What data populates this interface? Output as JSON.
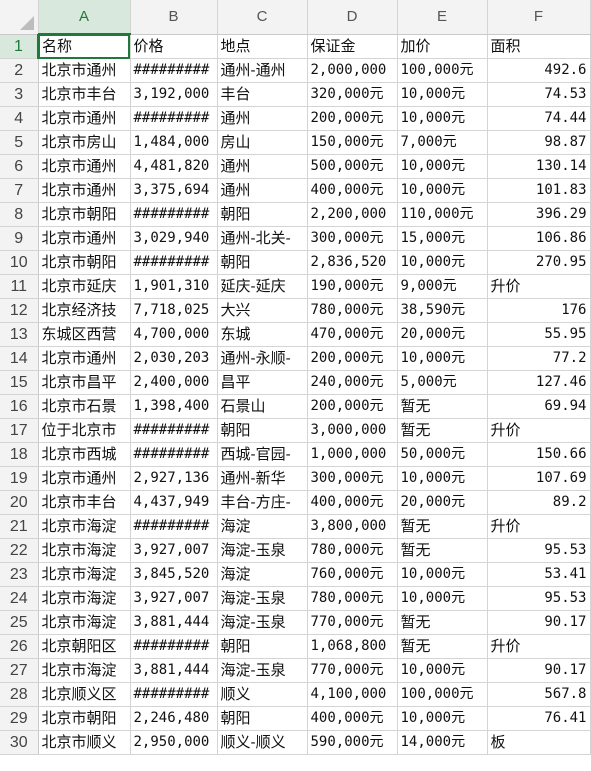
{
  "columns": [
    "A",
    "B",
    "C",
    "D",
    "E",
    "F"
  ],
  "active_column": "A",
  "active_row": 1,
  "rows": [
    {
      "n": "1",
      "cells": [
        "名称",
        "价格",
        "地点",
        "保证金",
        "加价",
        "面积"
      ]
    },
    {
      "n": "2",
      "cells": [
        "北京市通州",
        "#########",
        "通州-通州",
        "2,000,000",
        "100,000元",
        "492.6"
      ]
    },
    {
      "n": "3",
      "cells": [
        "北京市丰台",
        "3,192,000",
        "丰台",
        "320,000元",
        "10,000元",
        "74.53"
      ]
    },
    {
      "n": "4",
      "cells": [
        "北京市通州",
        "#########",
        "通州",
        "200,000元",
        "10,000元",
        "74.44"
      ]
    },
    {
      "n": "5",
      "cells": [
        "北京市房山",
        "1,484,000",
        "房山",
        "150,000元",
        "7,000元",
        "98.87"
      ]
    },
    {
      "n": "6",
      "cells": [
        "北京市通州",
        "4,481,820",
        "通州",
        "500,000元",
        "10,000元",
        "130.14"
      ]
    },
    {
      "n": "7",
      "cells": [
        "北京市通州",
        "3,375,694",
        "通州",
        "400,000元",
        "10,000元",
        "101.83"
      ]
    },
    {
      "n": "8",
      "cells": [
        "北京市朝阳",
        "#########",
        "朝阳",
        "2,200,000",
        "110,000元",
        "396.29"
      ]
    },
    {
      "n": "9",
      "cells": [
        "北京市通州",
        "3,029,940",
        "通州-北关-",
        "300,000元",
        "15,000元",
        "106.86"
      ]
    },
    {
      "n": "10",
      "cells": [
        "北京市朝阳",
        "#########",
        "朝阳",
        "2,836,520",
        "10,000元",
        "270.95"
      ]
    },
    {
      "n": "11",
      "cells": [
        "北京市延庆",
        "1,901,310",
        "延庆-延庆",
        "190,000元",
        "9,000元",
        "升价"
      ]
    },
    {
      "n": "12",
      "cells": [
        "北京经济技",
        "7,718,025",
        "大兴",
        "780,000元",
        "38,590元",
        "176"
      ]
    },
    {
      "n": "13",
      "cells": [
        "东城区西营",
        "4,700,000",
        "东城",
        "470,000元",
        "20,000元",
        "55.95"
      ]
    },
    {
      "n": "14",
      "cells": [
        "北京市通州",
        "2,030,203",
        "通州-永顺-",
        "200,000元",
        "10,000元",
        "77.2"
      ]
    },
    {
      "n": "15",
      "cells": [
        "北京市昌平",
        "2,400,000",
        "昌平",
        "240,000元",
        "5,000元",
        "127.46"
      ]
    },
    {
      "n": "16",
      "cells": [
        "北京市石景",
        "1,398,400",
        "石景山",
        "200,000元",
        "暂无",
        "69.94"
      ]
    },
    {
      "n": "17",
      "cells": [
        "位于北京市",
        "#########",
        "朝阳",
        "3,000,000",
        "暂无",
        "升价"
      ]
    },
    {
      "n": "18",
      "cells": [
        "北京市西城",
        "#########",
        "西城-官园-",
        "1,000,000",
        "50,000元",
        "150.66"
      ]
    },
    {
      "n": "19",
      "cells": [
        "北京市通州",
        "2,927,136",
        "通州-新华",
        "300,000元",
        "10,000元",
        "107.69"
      ]
    },
    {
      "n": "20",
      "cells": [
        "北京市丰台",
        "4,437,949",
        "丰台-方庄-",
        "400,000元",
        "20,000元",
        "89.2"
      ]
    },
    {
      "n": "21",
      "cells": [
        "北京市海淀",
        "#########",
        "海淀",
        "3,800,000",
        "暂无",
        "升价"
      ]
    },
    {
      "n": "22",
      "cells": [
        "北京市海淀",
        "3,927,007",
        "海淀-玉泉",
        "780,000元",
        "暂无",
        "95.53"
      ]
    },
    {
      "n": "23",
      "cells": [
        "北京市海淀",
        "3,845,520",
        "海淀",
        "760,000元",
        "10,000元",
        "53.41"
      ]
    },
    {
      "n": "24",
      "cells": [
        "北京市海淀",
        "3,927,007",
        "海淀-玉泉",
        "780,000元",
        "10,000元",
        "95.53"
      ]
    },
    {
      "n": "25",
      "cells": [
        "北京市海淀",
        "3,881,444",
        "海淀-玉泉",
        "770,000元",
        "暂无",
        "90.17"
      ]
    },
    {
      "n": "26",
      "cells": [
        "北京朝阳区",
        "#########",
        "朝阳",
        "1,068,800",
        "暂无",
        "升价"
      ]
    },
    {
      "n": "27",
      "cells": [
        "北京市海淀",
        "3,881,444",
        "海淀-玉泉",
        "770,000元",
        "10,000元",
        "90.17"
      ]
    },
    {
      "n": "28",
      "cells": [
        "北京顺义区",
        "#########",
        "顺义",
        "4,100,000",
        "100,000元",
        "567.8"
      ]
    },
    {
      "n": "29",
      "cells": [
        "北京市朝阳",
        "2,246,480",
        "朝阳",
        "400,000元",
        "10,000元",
        "76.41"
      ]
    },
    {
      "n": "30",
      "cells": [
        "北京市顺义",
        "2,950,000",
        "顺义-顺义",
        "590,000元",
        "14,000元",
        "板"
      ]
    }
  ]
}
